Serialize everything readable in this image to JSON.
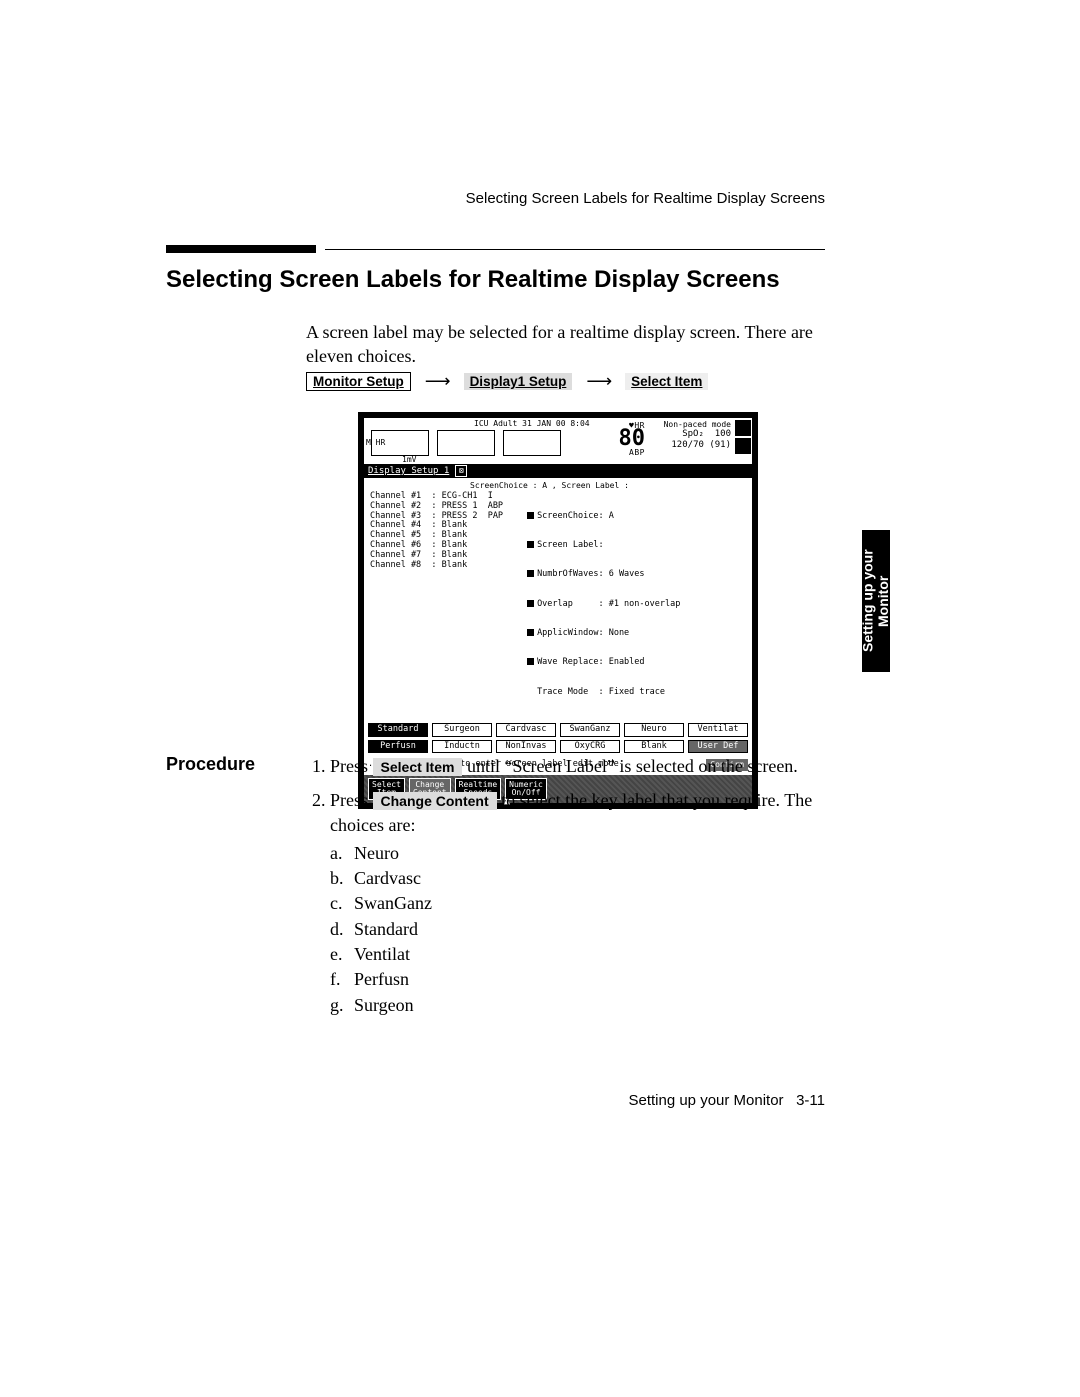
{
  "header": {
    "running": "Selecting Screen Labels for Realtime Display Screens"
  },
  "title": "Selecting Screen Labels for Realtime Display Screens",
  "intro": "A screen label may be selected for a realtime display screen. There are eleven choices.",
  "breadcrumb": {
    "a": "Monitor Setup",
    "b": "Display1 Setup",
    "c": "Select Item"
  },
  "monitor": {
    "meta": "ICU   Adult   31 JAN 00   8:04",
    "mhr": "M HR",
    "mv": "1mV",
    "hr_label": "♥HR",
    "hr_value": "80",
    "mode": "Non-paced mode",
    "spo2_label": "SpO₂",
    "spo2_value": "100",
    "abp_label": "ABP",
    "abp_value": "120/70 (91)",
    "setup_title": "Display Setup 1",
    "crumb_line": "ScreenChoice : A ,  Screen Label :",
    "left_col": "Channel #1  : ECG-CH1  I\nChannel #2  : PRESS 1  ABP\nChannel #3  : PRESS 2  PAP\nChannel #4  : Blank\nChannel #5  : Blank\nChannel #6  : Blank\nChannel #7  : Blank\nChannel #8  : Blank",
    "right_col": [
      "ScreenChoice: A",
      "Screen Label:",
      "NumbrOfWaves: 6 Waves",
      "Overlap     : #1 non-overlap",
      "ApplicWindow: None",
      "Wave Replace: Enabled",
      "Trace Mode  : Fixed trace"
    ],
    "presets_row1": [
      "Standard",
      "Surgeon",
      "Cardvasc",
      "SwanGanz",
      "Neuro",
      "Ventilat"
    ],
    "presets_row2": [
      "Perfusn",
      "Inductn",
      "NonInvas",
      "OxyCRG",
      "Blank",
      "User Def"
    ],
    "confirm_line": "... Press Confirm to enter screen label edit mode",
    "confirm_btn": "Confirm",
    "softkeys": {
      "select": "Select\nItem",
      "change": "Change\nContent",
      "realtime": "Realtime\nSpeeds",
      "numeric": "Numeric\nOn/Off"
    }
  },
  "side_tab": "Setting up your\nMonitor",
  "procedure_heading": "Procedure",
  "procedure": {
    "step1_a": "Press ",
    "step1_key": "Select Item",
    "step1_b": " until “Screen Label” is selected on the screen.",
    "step2_a": "Press ",
    "step2_key": "Change Content",
    "step2_b": " to select the key label that you require. The choices are:",
    "choices": [
      "Neuro",
      "Cardvasc",
      "SwanGanz",
      "Standard",
      "Ventilat",
      "Perfusn",
      "Surgeon"
    ]
  },
  "footer": {
    "text": "Setting up your Monitor",
    "page": "3-11"
  }
}
